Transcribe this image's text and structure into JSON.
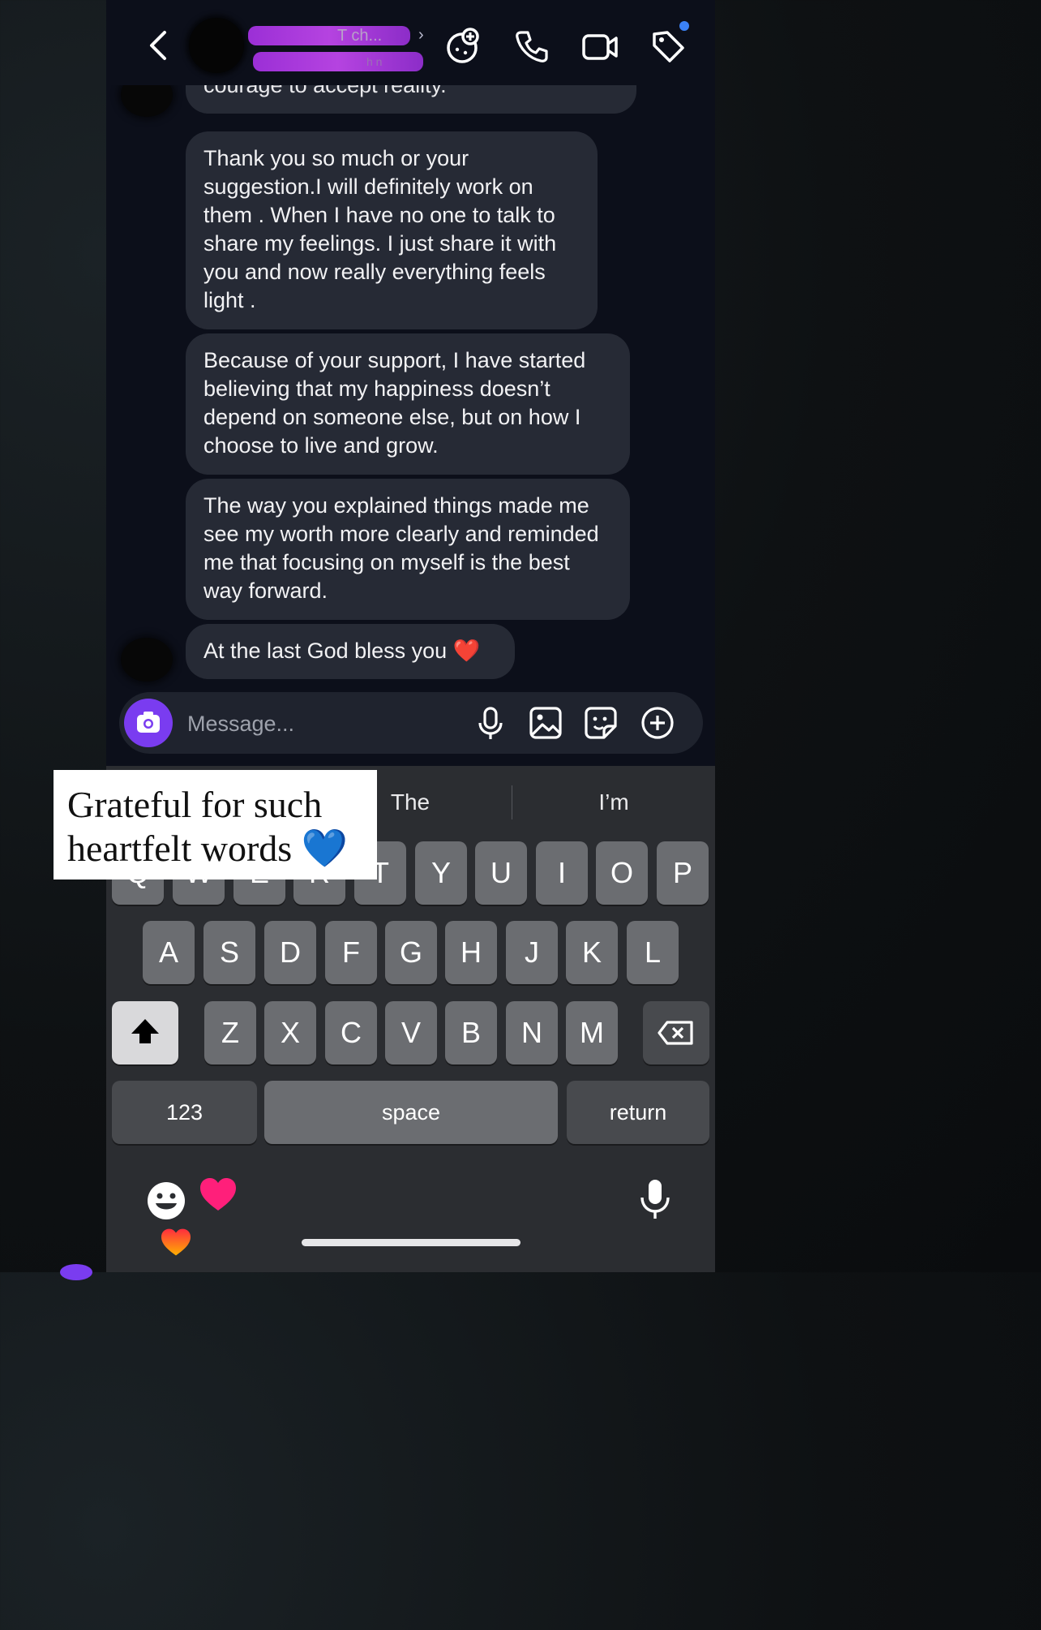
{
  "header": {
    "contact_name": "T  ch...",
    "contact_sub": "h n",
    "icons": [
      "back-icon",
      "add-effects-icon",
      "phone-icon",
      "video-icon",
      "tag-icon"
    ]
  },
  "messages": [
    {
      "text": "courage to accept reality."
    },
    {
      "text": "Thank you so much or your suggestion.I will definitely work on them . When I have no one to talk to share my feelings. I just share it with you and now really everything feels light ."
    },
    {
      "text": "Because of your support, I have started believing that my happiness doesn’t depend on someone else, but on how I choose to live and grow."
    },
    {
      "text": "The way you explained things made me see my worth more clearly and reminded me that focusing on myself is the best way forward."
    },
    {
      "text": "At the last God bless you ❤️"
    }
  ],
  "composer": {
    "placeholder": "Message...",
    "icons": [
      "camera-icon",
      "microphone-icon",
      "gallery-icon",
      "sticker-icon",
      "plus-icon"
    ]
  },
  "keyboard": {
    "suggestions": [
      "The",
      "I’m"
    ],
    "row1": [
      "Q",
      "W",
      "E",
      "R",
      "T",
      "Y",
      "U",
      "I",
      "O",
      "P"
    ],
    "row2": [
      "A",
      "S",
      "D",
      "F",
      "G",
      "H",
      "J",
      "K",
      "L"
    ],
    "row3": [
      "Z",
      "X",
      "C",
      "V",
      "B",
      "N",
      "M"
    ],
    "numbers_label": "123",
    "space_label": "space",
    "return_label": "return"
  },
  "caption": {
    "line1": "Grateful for such",
    "line2": "heartfelt words 💙"
  },
  "colors": {
    "accent": "#7a3cf0",
    "bubble": "#262a35",
    "background": "#0c0f1a",
    "keyboard": "#2b2d31",
    "notification_dot": "#3b82f6"
  }
}
